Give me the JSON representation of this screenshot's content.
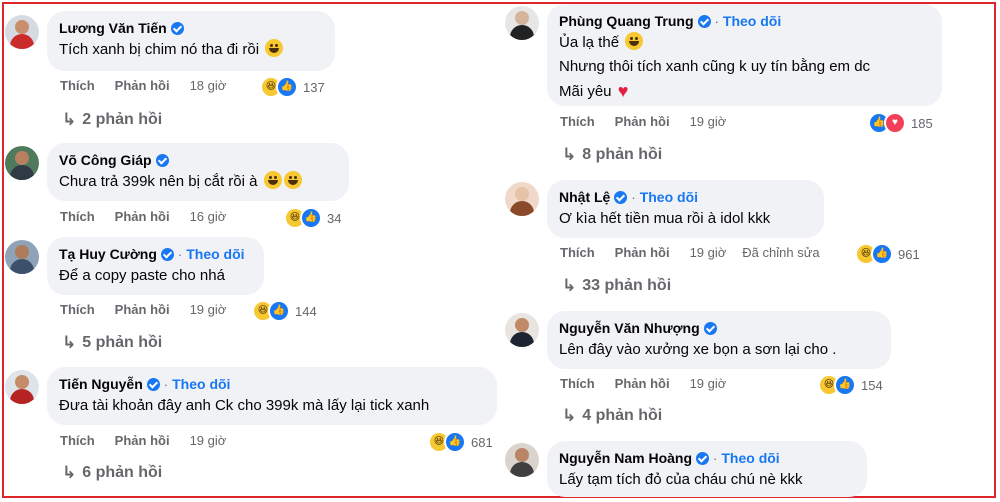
{
  "labels": {
    "like": "Thích",
    "reply": "Phản hồi",
    "follow": "Theo dõi",
    "dot": "·"
  },
  "left": [
    {
      "name": "Lương Văn Tiến",
      "verified": true,
      "follow": false,
      "text": "Tích xanh bị chim nó tha đi rồi",
      "emoji": "haha",
      "time": "18 giờ",
      "reactions": [
        "haha",
        "like"
      ],
      "count": "137",
      "replies": "2 phản hồi",
      "avatar": {
        "bg": "#d6dbe3",
        "skin": "#c98f6c",
        "shirt": "#cc2b2b"
      }
    },
    {
      "name": "Võ Công Giáp",
      "verified": true,
      "follow": false,
      "text": "Chưa trả 399k nên bị cắt rồi à",
      "emoji": "haha2",
      "time": "16 giờ",
      "reactions": [
        "haha",
        "like"
      ],
      "count": "34",
      "replies": null,
      "avatar": {
        "bg": "#4f7a5d",
        "skin": "#b88060",
        "shirt": "#2f3a45"
      }
    },
    {
      "name": "Tạ Huy Cường",
      "verified": true,
      "follow": true,
      "text": "Để a copy paste cho nhá",
      "emoji": "",
      "time": "19 giờ",
      "reactions": [
        "haha",
        "like"
      ],
      "count": "144",
      "replies": "5 phản hồi",
      "avatar": {
        "bg": "#8fa3b8",
        "skin": "#b07b5b",
        "shirt": "#3c4f6b"
      }
    },
    {
      "name": "Tiến Nguyễn",
      "verified": true,
      "follow": true,
      "text": "Đưa tài khoản đây anh Ck cho 399k mà lấy lại tick xanh",
      "emoji": "",
      "time": "19 giờ",
      "reactions": [
        "haha",
        "like"
      ],
      "count": "681",
      "replies": "6 phản hồi",
      "avatar": {
        "bg": "#dfe3ea",
        "skin": "#c48c68",
        "shirt": "#b52323"
      }
    }
  ],
  "right": [
    {
      "name": "Phùng Quang Trung",
      "verified": true,
      "follow": true,
      "lines": [
        "Ủa lạ thế",
        "Nhưng thôi tích xanh cũng k uy tín bằng em dc",
        "Mãi yêu"
      ],
      "time": "19 giờ",
      "reactions": [
        "like",
        "love"
      ],
      "count": "185",
      "replies": "8 phản hồi",
      "avatar": {
        "bg": "#e6e6e6",
        "skin": "#d5b49a",
        "shirt": "#222222"
      }
    },
    {
      "name": "Nhật Lệ",
      "verified": true,
      "follow": true,
      "text": "Ơ kìa hết tiền mua rồi à idol kkk",
      "time": "19 giờ",
      "edited": "Đã chỉnh sửa",
      "reactions": [
        "haha",
        "like"
      ],
      "count": "961",
      "replies": "33 phản hồi",
      "avatar": {
        "bg": "#f0d9c8",
        "skin": "#e6c2a6",
        "shirt": "#8a4a2a"
      }
    },
    {
      "name": "Nguyễn Văn Nhượng",
      "verified": true,
      "follow": false,
      "text": "Lên đây vào xưởng xe bọn a sơn lại cho .",
      "time": "19 giờ",
      "reactions": [
        "haha",
        "like"
      ],
      "count": "154",
      "replies": "4 phản hồi",
      "avatar": {
        "bg": "#e8e4df",
        "skin": "#c08a66",
        "shirt": "#1d2530"
      }
    },
    {
      "name": "Nguyễn Nam Hoàng",
      "verified": true,
      "follow": true,
      "text": "Lấy tạm tích đỏ của cháu chú nè kkk",
      "avatar": {
        "bg": "#d9d4cc",
        "skin": "#b98565",
        "shirt": "#3f3f3f"
      }
    }
  ]
}
